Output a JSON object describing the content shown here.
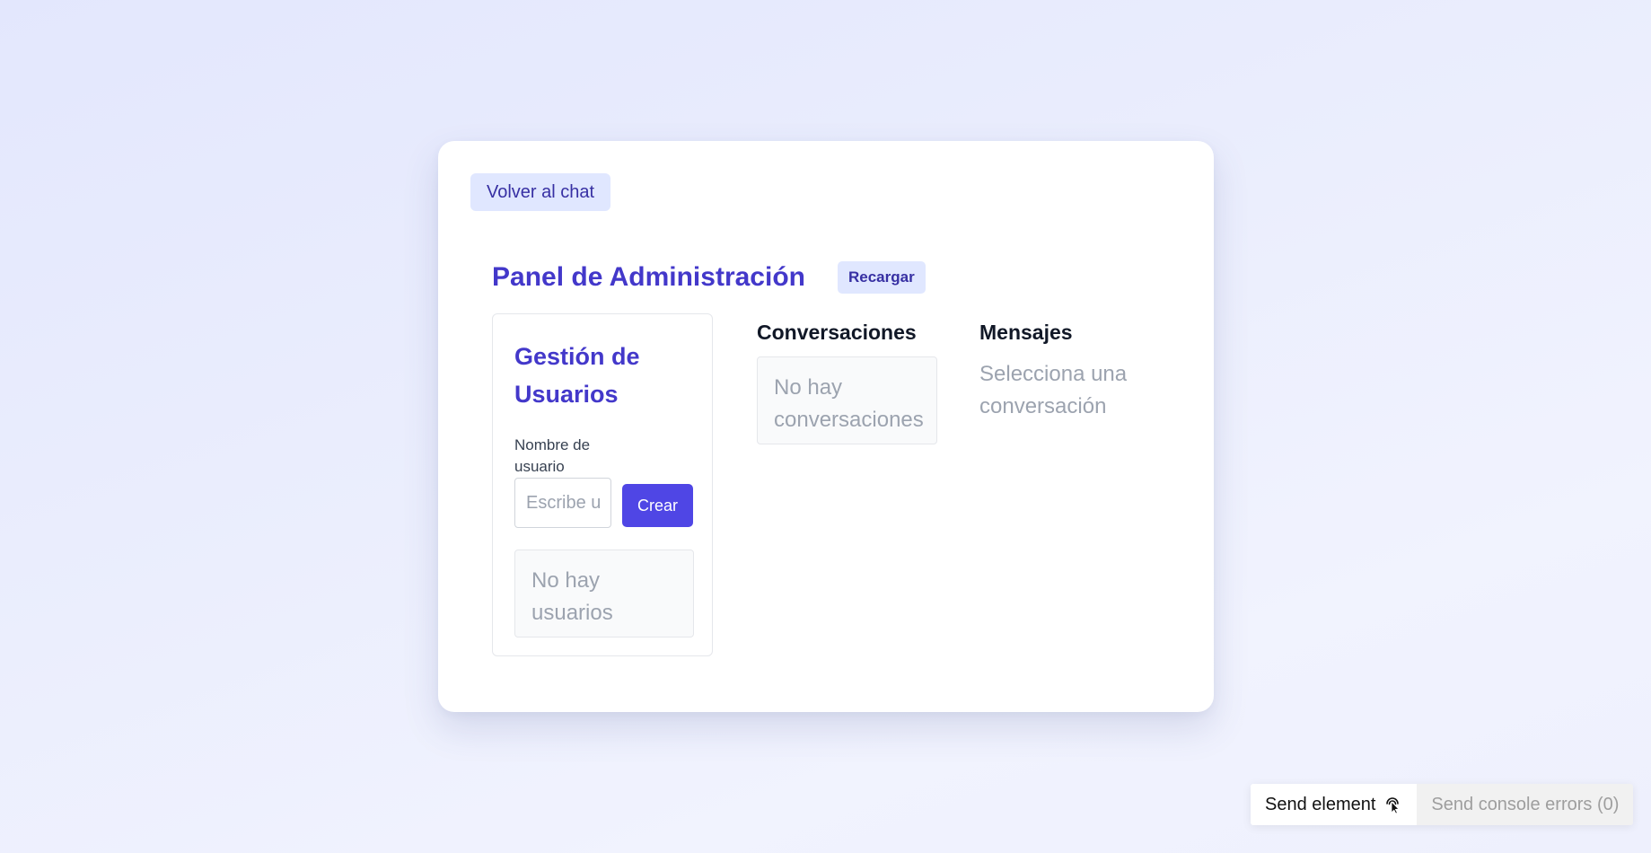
{
  "back_button": {
    "label": "Volver al chat"
  },
  "header": {
    "title": "Panel de Administración",
    "reload_label": "Recargar"
  },
  "users": {
    "title": "Gestión de Usuarios",
    "username_label": "Nombre de usuario",
    "username_placeholder": "Escribe un nombre",
    "username_value": "",
    "create_label": "Crear",
    "empty_text": "No hay usuarios"
  },
  "conversations": {
    "title": "Conversaciones",
    "empty_text": "No hay conversaciones"
  },
  "messages": {
    "title": "Mensajes",
    "placeholder_text": "Selecciona una conversación"
  },
  "devtools": {
    "send_element_label": "Send element",
    "send_element_icon": "pointer-cursor-icon",
    "send_errors_label": "Send console errors (0)"
  },
  "colors": {
    "accent": "#4f46e5",
    "heading": "#4338ca",
    "soft_button_bg": "#e0e7ff",
    "muted_text": "#9ca3af"
  }
}
